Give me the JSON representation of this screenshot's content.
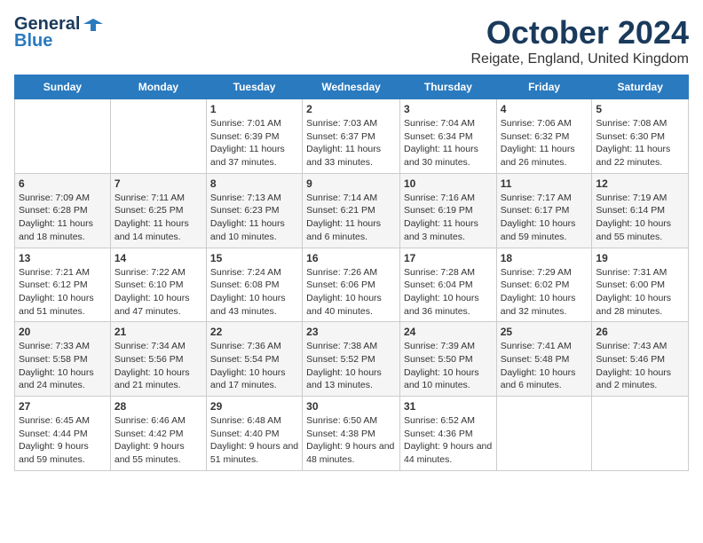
{
  "header": {
    "logo_general": "General",
    "logo_blue": "Blue",
    "month": "October 2024",
    "location": "Reigate, England, United Kingdom"
  },
  "days_of_week": [
    "Sunday",
    "Monday",
    "Tuesday",
    "Wednesday",
    "Thursday",
    "Friday",
    "Saturday"
  ],
  "weeks": [
    [
      {
        "day": "",
        "sunrise": "",
        "sunset": "",
        "daylight": ""
      },
      {
        "day": "",
        "sunrise": "",
        "sunset": "",
        "daylight": ""
      },
      {
        "day": "1",
        "sunrise": "Sunrise: 7:01 AM",
        "sunset": "Sunset: 6:39 PM",
        "daylight": "Daylight: 11 hours and 37 minutes."
      },
      {
        "day": "2",
        "sunrise": "Sunrise: 7:03 AM",
        "sunset": "Sunset: 6:37 PM",
        "daylight": "Daylight: 11 hours and 33 minutes."
      },
      {
        "day": "3",
        "sunrise": "Sunrise: 7:04 AM",
        "sunset": "Sunset: 6:34 PM",
        "daylight": "Daylight: 11 hours and 30 minutes."
      },
      {
        "day": "4",
        "sunrise": "Sunrise: 7:06 AM",
        "sunset": "Sunset: 6:32 PM",
        "daylight": "Daylight: 11 hours and 26 minutes."
      },
      {
        "day": "5",
        "sunrise": "Sunrise: 7:08 AM",
        "sunset": "Sunset: 6:30 PM",
        "daylight": "Daylight: 11 hours and 22 minutes."
      }
    ],
    [
      {
        "day": "6",
        "sunrise": "Sunrise: 7:09 AM",
        "sunset": "Sunset: 6:28 PM",
        "daylight": "Daylight: 11 hours and 18 minutes."
      },
      {
        "day": "7",
        "sunrise": "Sunrise: 7:11 AM",
        "sunset": "Sunset: 6:25 PM",
        "daylight": "Daylight: 11 hours and 14 minutes."
      },
      {
        "day": "8",
        "sunrise": "Sunrise: 7:13 AM",
        "sunset": "Sunset: 6:23 PM",
        "daylight": "Daylight: 11 hours and 10 minutes."
      },
      {
        "day": "9",
        "sunrise": "Sunrise: 7:14 AM",
        "sunset": "Sunset: 6:21 PM",
        "daylight": "Daylight: 11 hours and 6 minutes."
      },
      {
        "day": "10",
        "sunrise": "Sunrise: 7:16 AM",
        "sunset": "Sunset: 6:19 PM",
        "daylight": "Daylight: 11 hours and 3 minutes."
      },
      {
        "day": "11",
        "sunrise": "Sunrise: 7:17 AM",
        "sunset": "Sunset: 6:17 PM",
        "daylight": "Daylight: 10 hours and 59 minutes."
      },
      {
        "day": "12",
        "sunrise": "Sunrise: 7:19 AM",
        "sunset": "Sunset: 6:14 PM",
        "daylight": "Daylight: 10 hours and 55 minutes."
      }
    ],
    [
      {
        "day": "13",
        "sunrise": "Sunrise: 7:21 AM",
        "sunset": "Sunset: 6:12 PM",
        "daylight": "Daylight: 10 hours and 51 minutes."
      },
      {
        "day": "14",
        "sunrise": "Sunrise: 7:22 AM",
        "sunset": "Sunset: 6:10 PM",
        "daylight": "Daylight: 10 hours and 47 minutes."
      },
      {
        "day": "15",
        "sunrise": "Sunrise: 7:24 AM",
        "sunset": "Sunset: 6:08 PM",
        "daylight": "Daylight: 10 hours and 43 minutes."
      },
      {
        "day": "16",
        "sunrise": "Sunrise: 7:26 AM",
        "sunset": "Sunset: 6:06 PM",
        "daylight": "Daylight: 10 hours and 40 minutes."
      },
      {
        "day": "17",
        "sunrise": "Sunrise: 7:28 AM",
        "sunset": "Sunset: 6:04 PM",
        "daylight": "Daylight: 10 hours and 36 minutes."
      },
      {
        "day": "18",
        "sunrise": "Sunrise: 7:29 AM",
        "sunset": "Sunset: 6:02 PM",
        "daylight": "Daylight: 10 hours and 32 minutes."
      },
      {
        "day": "19",
        "sunrise": "Sunrise: 7:31 AM",
        "sunset": "Sunset: 6:00 PM",
        "daylight": "Daylight: 10 hours and 28 minutes."
      }
    ],
    [
      {
        "day": "20",
        "sunrise": "Sunrise: 7:33 AM",
        "sunset": "Sunset: 5:58 PM",
        "daylight": "Daylight: 10 hours and 24 minutes."
      },
      {
        "day": "21",
        "sunrise": "Sunrise: 7:34 AM",
        "sunset": "Sunset: 5:56 PM",
        "daylight": "Daylight: 10 hours and 21 minutes."
      },
      {
        "day": "22",
        "sunrise": "Sunrise: 7:36 AM",
        "sunset": "Sunset: 5:54 PM",
        "daylight": "Daylight: 10 hours and 17 minutes."
      },
      {
        "day": "23",
        "sunrise": "Sunrise: 7:38 AM",
        "sunset": "Sunset: 5:52 PM",
        "daylight": "Daylight: 10 hours and 13 minutes."
      },
      {
        "day": "24",
        "sunrise": "Sunrise: 7:39 AM",
        "sunset": "Sunset: 5:50 PM",
        "daylight": "Daylight: 10 hours and 10 minutes."
      },
      {
        "day": "25",
        "sunrise": "Sunrise: 7:41 AM",
        "sunset": "Sunset: 5:48 PM",
        "daylight": "Daylight: 10 hours and 6 minutes."
      },
      {
        "day": "26",
        "sunrise": "Sunrise: 7:43 AM",
        "sunset": "Sunset: 5:46 PM",
        "daylight": "Daylight: 10 hours and 2 minutes."
      }
    ],
    [
      {
        "day": "27",
        "sunrise": "Sunrise: 6:45 AM",
        "sunset": "Sunset: 4:44 PM",
        "daylight": "Daylight: 9 hours and 59 minutes."
      },
      {
        "day": "28",
        "sunrise": "Sunrise: 6:46 AM",
        "sunset": "Sunset: 4:42 PM",
        "daylight": "Daylight: 9 hours and 55 minutes."
      },
      {
        "day": "29",
        "sunrise": "Sunrise: 6:48 AM",
        "sunset": "Sunset: 4:40 PM",
        "daylight": "Daylight: 9 hours and 51 minutes."
      },
      {
        "day": "30",
        "sunrise": "Sunrise: 6:50 AM",
        "sunset": "Sunset: 4:38 PM",
        "daylight": "Daylight: 9 hours and 48 minutes."
      },
      {
        "day": "31",
        "sunrise": "Sunrise: 6:52 AM",
        "sunset": "Sunset: 4:36 PM",
        "daylight": "Daylight: 9 hours and 44 minutes."
      },
      {
        "day": "",
        "sunrise": "",
        "sunset": "",
        "daylight": ""
      },
      {
        "day": "",
        "sunrise": "",
        "sunset": "",
        "daylight": ""
      }
    ]
  ]
}
